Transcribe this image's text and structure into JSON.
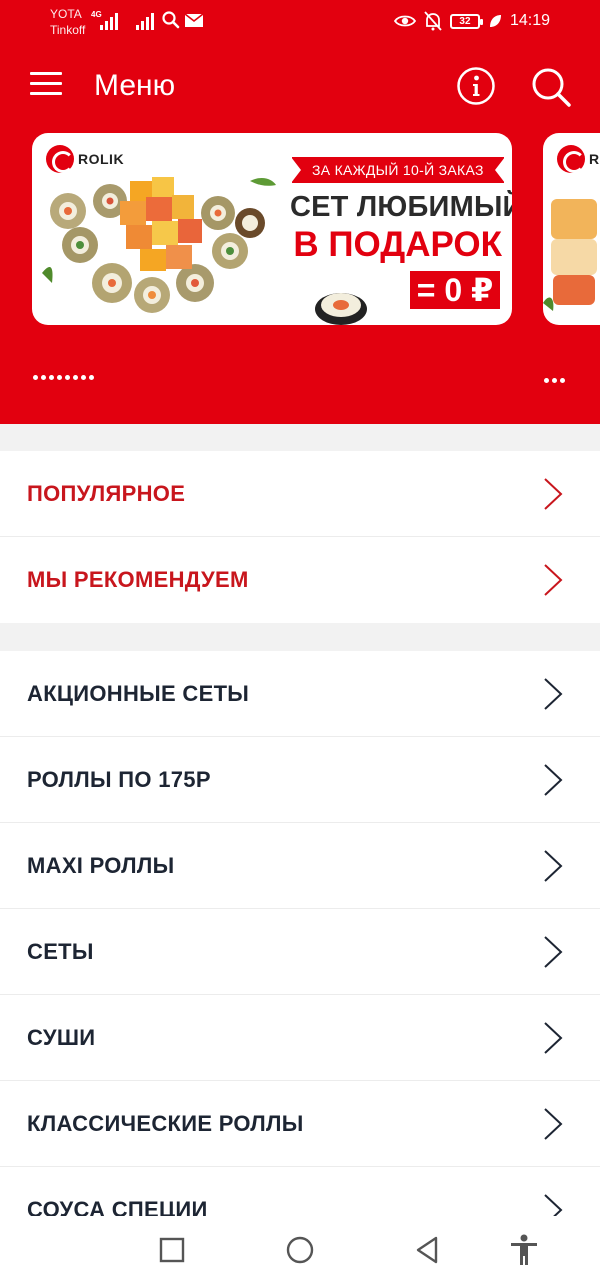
{
  "status_bar": {
    "carrier1": "YOTA",
    "carrier2": "Tinkoff",
    "network": "4G",
    "battery": "32",
    "time": "14:19"
  },
  "app_bar": {
    "title": "Меню",
    "menu_icon": "hamburger-icon",
    "info_icon": "info-icon",
    "search_icon": "search-icon"
  },
  "banner": {
    "logo_text": "ROLIK",
    "ribbon": "ЗА КАЖДЫЙ 10-Й ЗАКАЗ",
    "headline1": "СЕТ ЛЮБИМЫЙ",
    "headline2": "В ПОДАРОК",
    "price": "= 0 ₽",
    "next_logo_text": "RO"
  },
  "colors": {
    "brand": "#e2000f",
    "featured_text": "#c8161d",
    "category_text": "#1d2533"
  },
  "featured": [
    {
      "label": "ПОПУЛЯРНОЕ"
    },
    {
      "label": "МЫ РЕКОМЕНДУЕМ"
    }
  ],
  "categories": [
    {
      "label": "АКЦИОННЫЕ СЕТЫ"
    },
    {
      "label": "РОЛЛЫ ПО 175Р"
    },
    {
      "label": "MAXI РОЛЛЫ"
    },
    {
      "label": "СЕТЫ"
    },
    {
      "label": "СУШИ"
    },
    {
      "label": "КЛАССИЧЕСКИЕ РОЛЛЫ"
    },
    {
      "label": "СОУСА СПЕЦИИ"
    }
  ],
  "nav": {
    "recent_icon": "square-icon",
    "home_icon": "circle-icon",
    "back_icon": "triangle-back-icon",
    "accessibility_icon": "accessibility-icon"
  }
}
